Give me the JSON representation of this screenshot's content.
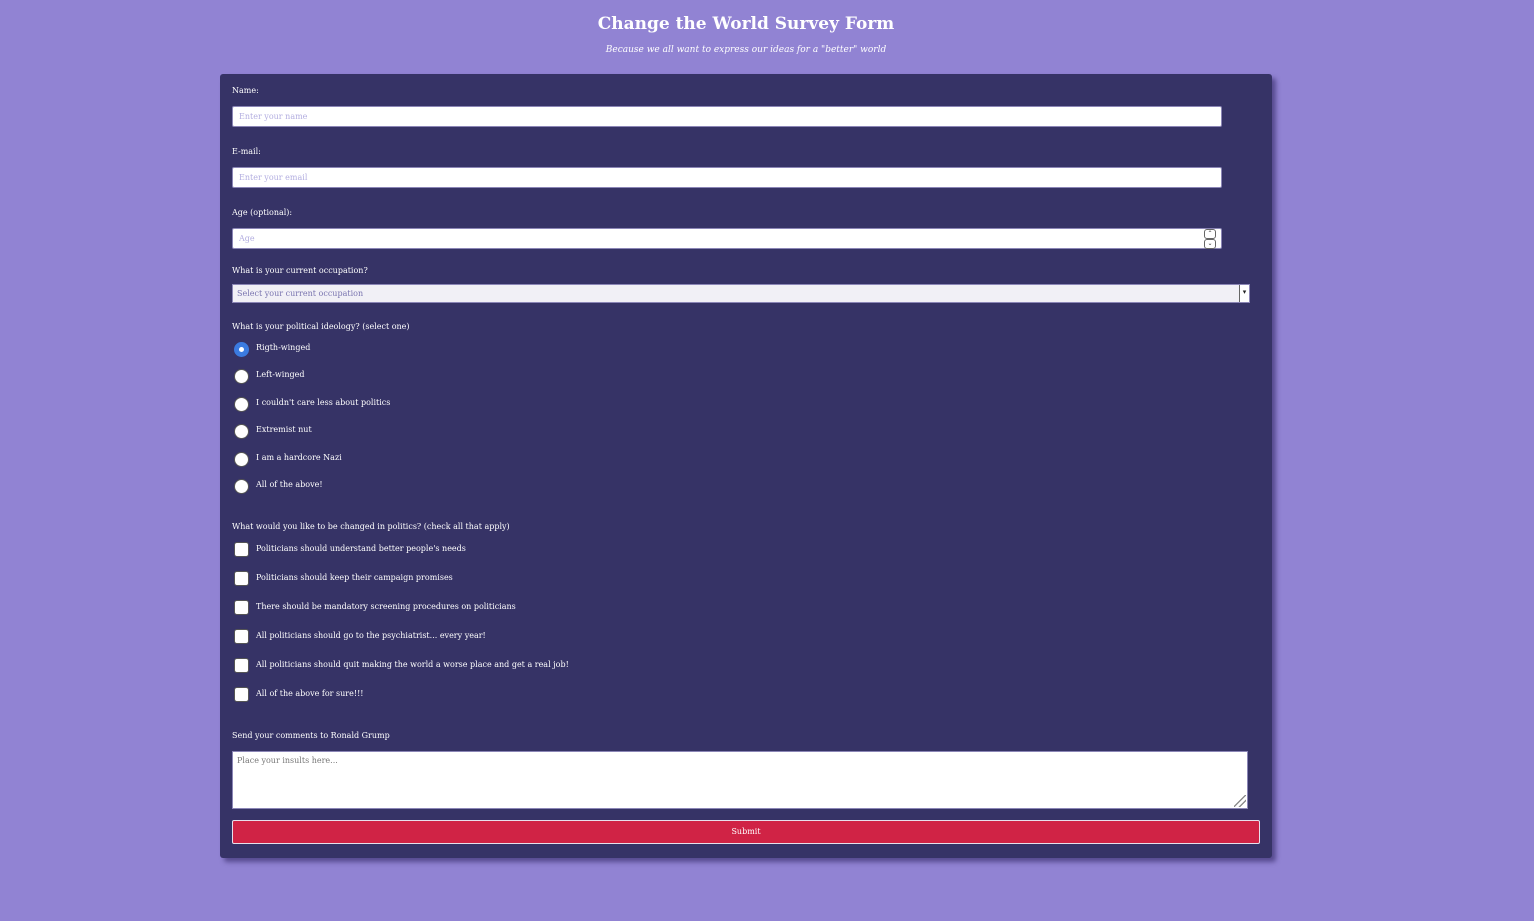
{
  "header": {
    "title": "Change the World Survey Form",
    "subtitle": "Because we all want to express our ideas for a \"better\" world"
  },
  "form": {
    "name": {
      "label": "Name:",
      "placeholder": "Enter your name",
      "value": ""
    },
    "email": {
      "label": "E-mail:",
      "placeholder": "Enter your email",
      "value": ""
    },
    "age": {
      "label": "Age (optional):",
      "placeholder": "Age",
      "value": ""
    },
    "occupation": {
      "label": "What is your current occupation?",
      "selected": "Select your current occupation"
    },
    "ideology": {
      "label": "What is your political ideology? (select one)",
      "options": [
        {
          "label": "Rigth-winged",
          "checked": true
        },
        {
          "label": "Left-winged",
          "checked": false
        },
        {
          "label": "I couldn't care less about politics",
          "checked": false
        },
        {
          "label": "Extremist nut",
          "checked": false
        },
        {
          "label": "I am a hardcore Nazi",
          "checked": false
        },
        {
          "label": "All of the above!",
          "checked": false
        }
      ]
    },
    "changes": {
      "label": "What would you like to be changed in politics? (check all that apply)",
      "options": [
        {
          "label": "Politicians should understand better people's needs",
          "checked": false
        },
        {
          "label": "Politicians should keep their campaign promises",
          "checked": false
        },
        {
          "label": "There should be mandatory screening procedures on politicians",
          "checked": false
        },
        {
          "label": "All politicians should go to the psychiatrist... every year!",
          "checked": false
        },
        {
          "label": "All politicians should quit making the world a worse place and get a real job!",
          "checked": false
        },
        {
          "label": "All of the above for sure!!!",
          "checked": false
        }
      ]
    },
    "comments": {
      "label": "Send your comments to Ronald Grump",
      "placeholder": "Place your insults here..."
    },
    "submit_label": "Submit"
  },
  "colors": {
    "page_background": "#9183d3",
    "card_background": "#363366",
    "submit_background": "#d02345",
    "radio_selected": "#3b7be0"
  },
  "icons": {
    "spinner_up": "chevron-up-icon",
    "spinner_down": "chevron-down-icon",
    "select_arrow": "caret-down-icon",
    "resize": "resize-grip-icon"
  }
}
